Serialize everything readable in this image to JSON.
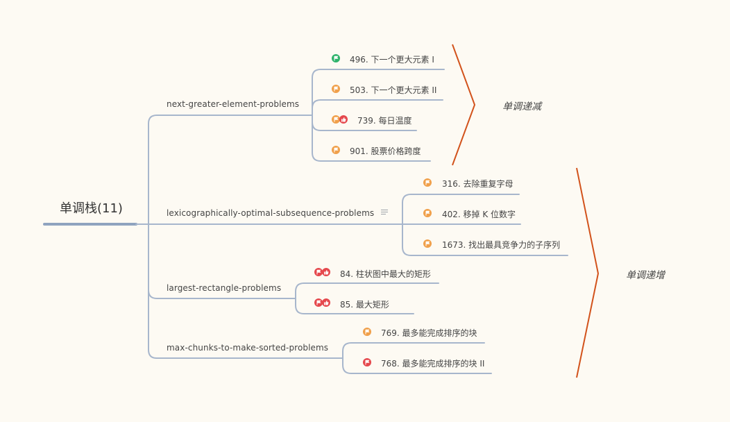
{
  "colors": {
    "green": "#2fb36b",
    "orange": "#f0a04b",
    "red": "#e5484d",
    "line": "#a7b6cc",
    "root_line": "#8fa3bf",
    "bracket": "#d2521b"
  },
  "root": {
    "label": "单调栈(11)"
  },
  "branches": [
    {
      "label": "next-greater-element-problems",
      "leaves": [
        {
          "label": "496. 下一个更大元素 I",
          "icons": [
            "green-flag-icon"
          ]
        },
        {
          "label": "503. 下一个更大元素 II",
          "icons": [
            "orange-flag-icon"
          ]
        },
        {
          "label": "739. 每日温度",
          "icons": [
            "orange-flag-icon",
            "red-thumbs-up-icon"
          ]
        },
        {
          "label": "901. 股票价格跨度",
          "icons": [
            "orange-flag-icon"
          ]
        }
      ]
    },
    {
      "label": "lexicographically-optimal-subsequence-problems",
      "leaves": [
        {
          "label": "316. 去除重复字母",
          "icons": [
            "orange-flag-icon"
          ]
        },
        {
          "label": "402. 移掉 K 位数字",
          "icons": [
            "orange-flag-icon"
          ]
        },
        {
          "label": "1673. 找出最具竞争力的子序列",
          "icons": [
            "orange-flag-icon"
          ]
        }
      ]
    },
    {
      "label": "largest-rectangle-problems",
      "leaves": [
        {
          "label": "84. 柱状图中最大的矩形",
          "icons": [
            "red-flag-icon",
            "red-thumbs-up-icon"
          ]
        },
        {
          "label": "85. 最大矩形",
          "icons": [
            "red-flag-icon",
            "red-thumbs-up-icon"
          ]
        }
      ]
    },
    {
      "label": "max-chunks-to-make-sorted-problems",
      "leaves": [
        {
          "label": "769. 最多能完成排序的块",
          "icons": [
            "orange-flag-icon"
          ]
        },
        {
          "label": "768. 最多能完成排序的块 II",
          "icons": [
            "red-flag-icon"
          ]
        }
      ]
    }
  ],
  "summaries": [
    {
      "label": "单调递减"
    },
    {
      "label": "单调递增"
    }
  ]
}
